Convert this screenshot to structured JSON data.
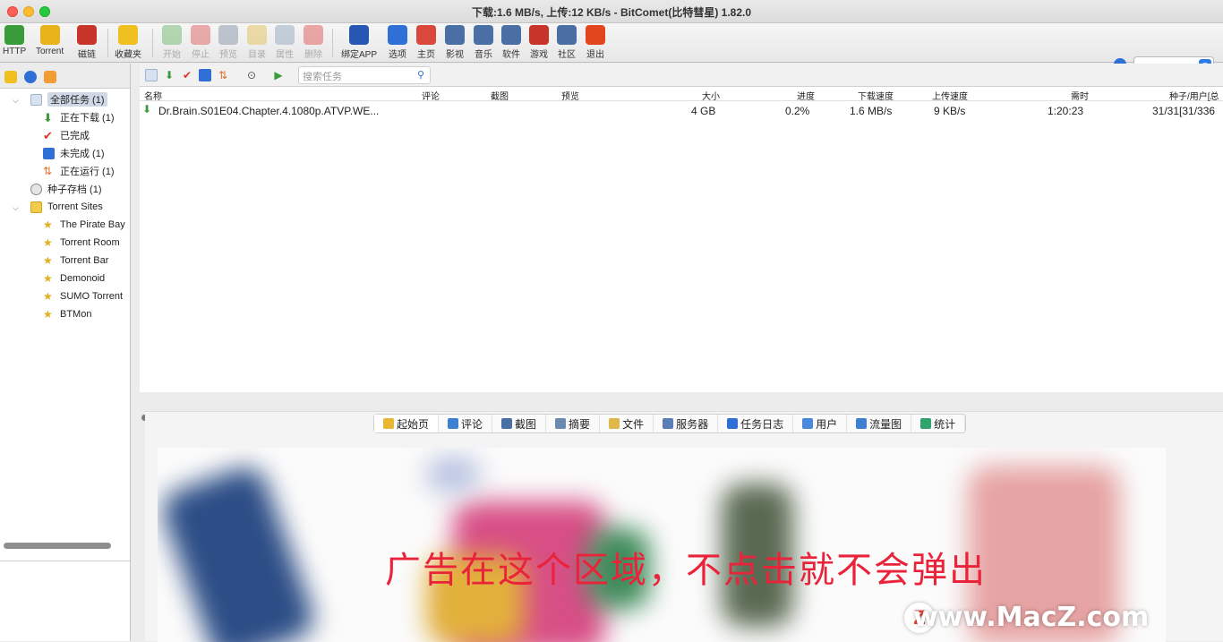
{
  "window": {
    "title": "下载:1.6 MB/s, 上传:12 KB/s - BitComet(比特彗星) 1.82.0"
  },
  "toolbar": {
    "items": [
      {
        "label": "HTTP",
        "icon": "http-add-icon",
        "color": "#3a9b3a"
      },
      {
        "label": "Torrent",
        "icon": "torrent-add-icon",
        "color": "#e8b21b"
      },
      {
        "label": "磁链",
        "icon": "magnet-icon",
        "color": "#c9342a"
      },
      {
        "label": "收藏夹",
        "icon": "favorites-star-icon",
        "color": "#f0c020"
      },
      {
        "label": "开始",
        "icon": "start-icon",
        "color": "#5fb25f"
      },
      {
        "label": "停止",
        "icon": "stop-icon",
        "color": "#d9534f"
      },
      {
        "label": "预览",
        "icon": "preview-icon",
        "color": "#7a8aa0"
      },
      {
        "label": "目录",
        "icon": "folder-icon",
        "color": "#e0b84a"
      },
      {
        "label": "属性",
        "icon": "properties-icon",
        "color": "#8aa0b8"
      },
      {
        "label": "删除",
        "icon": "delete-icon",
        "color": "#d44"
      },
      {
        "label": "绑定APP",
        "icon": "bind-app-icon",
        "color": "#2557b3"
      },
      {
        "label": "选项",
        "icon": "options-icon",
        "color": "#2f6fd6"
      },
      {
        "label": "主页",
        "icon": "home-icon",
        "color": "#d9483b"
      },
      {
        "label": "影视",
        "icon": "video-icon",
        "color": "#4a6fa5"
      },
      {
        "label": "音乐",
        "icon": "music-icon",
        "color": "#4a6fa5"
      },
      {
        "label": "软件",
        "icon": "software-icon",
        "color": "#4a6fa5"
      },
      {
        "label": "游戏",
        "icon": "game-icon",
        "color": "#c9342a"
      },
      {
        "label": "社区",
        "icon": "community-icon",
        "color": "#4a6fa5"
      },
      {
        "label": "退出",
        "icon": "exit-icon",
        "color": "#e2461f"
      }
    ]
  },
  "sidebar": {
    "all_tasks": "全部任务 (1)",
    "downloading": "正在下载 (1)",
    "completed": "已完成",
    "incomplete": "未完成 (1)",
    "running": "正在运行 (1)",
    "torrent_archive": "种子存档 (1)",
    "torrent_sites": "Torrent Sites",
    "sites": [
      "The Pirate Bay",
      "Torrent Room",
      "Torrent Bar",
      "Demonoid",
      "SUMO Torrent",
      "BTMon"
    ]
  },
  "search": {
    "placeholder": "搜索任务"
  },
  "columns": {
    "name": "名称",
    "comment": "评论",
    "screenshot": "截图",
    "preview": "预览",
    "size": "大小",
    "progress": "进度",
    "down_speed": "下载速度",
    "up_speed": "上传速度",
    "eta": "需时",
    "seeds": "种子/用户[总"
  },
  "task": {
    "name": "Dr.Brain.S01E04.Chapter.4.1080p.ATVP.WE...",
    "size": "4 GB",
    "progress": "0.2%",
    "down_speed": "1.6 MB/s",
    "up_speed": "9 KB/s",
    "eta": "1:20:23",
    "seeds": "31/31[31/336"
  },
  "tabs": [
    "起始页",
    "评论",
    "截图",
    "摘要",
    "文件",
    "服务器",
    "任务日志",
    "用户",
    "流量图",
    "统计"
  ],
  "ad": {
    "text": "广告在这个区域，不点击就不会弹出"
  },
  "watermark": {
    "text": "www.MacZ.com",
    "badge": "Z"
  }
}
